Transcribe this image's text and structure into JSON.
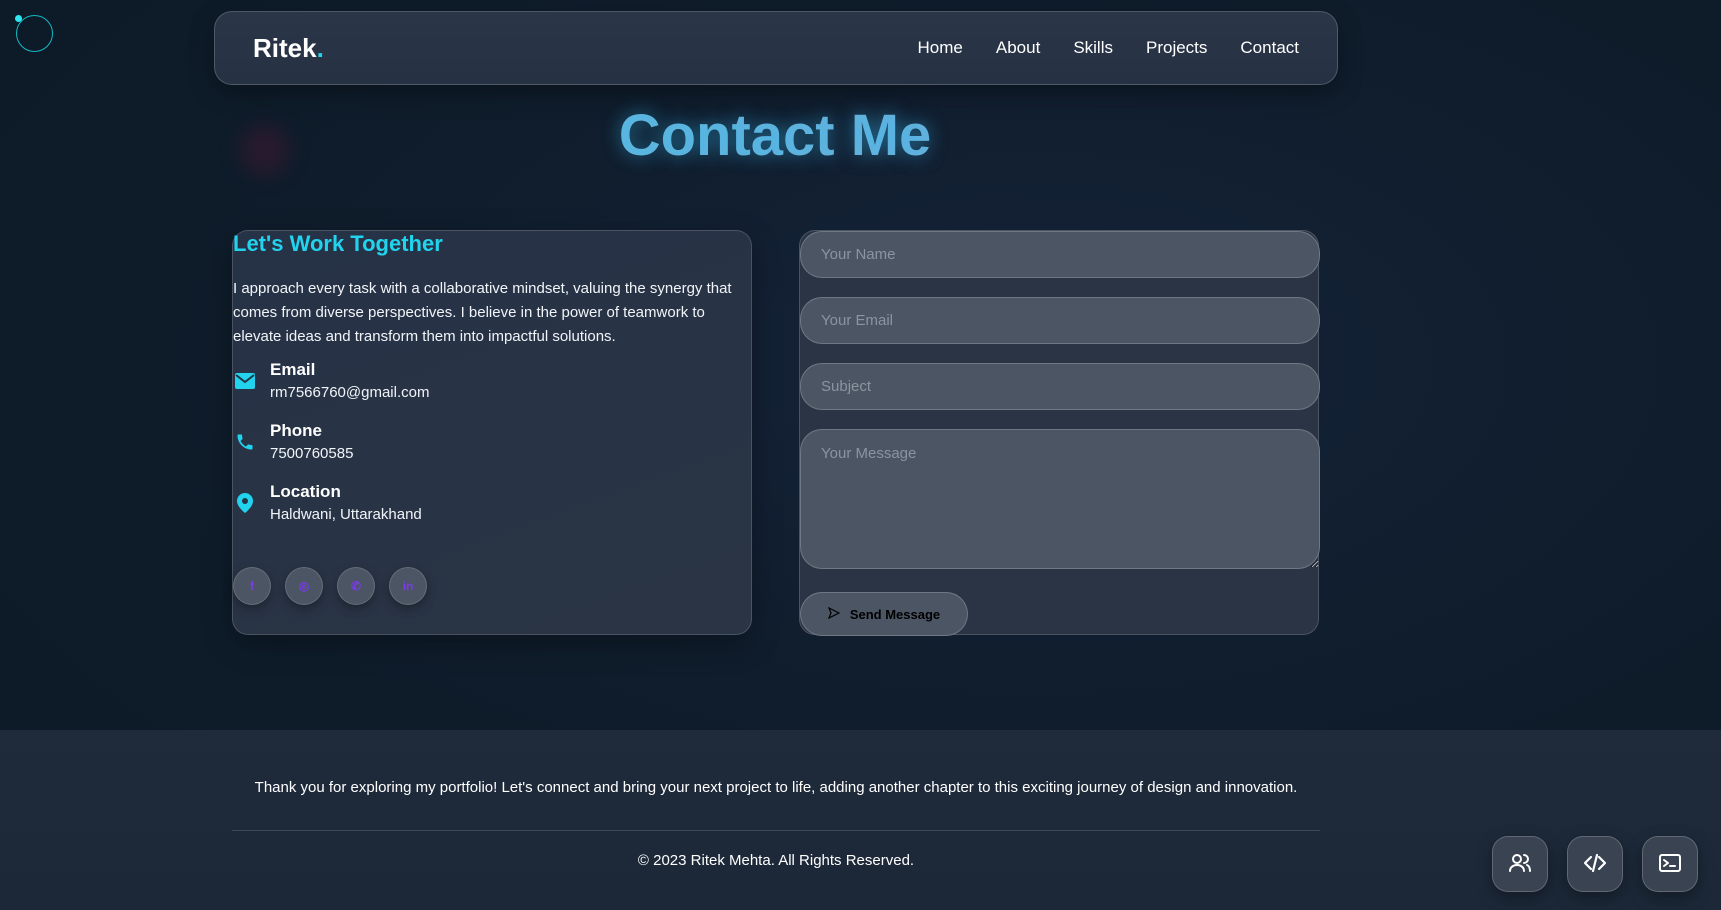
{
  "nav": {
    "logo_text": "Ritek",
    "logo_dot": ".",
    "links": [
      "Home",
      "About",
      "Skills",
      "Projects",
      "Contact"
    ]
  },
  "page_title": "Contact Me",
  "contact_info": {
    "heading": "Let's Work Together",
    "intro": "I approach every task with a collaborative mindset, valuing the synergy that comes from diverse perspectives. I believe in the power of teamwork to elevate ideas and transform them into impactful solutions.",
    "items": [
      {
        "label": "Email",
        "value": "rm7566760@gmail.com",
        "icon": "mail-icon"
      },
      {
        "label": "Phone",
        "value": "7500760585",
        "icon": "phone-icon"
      },
      {
        "label": "Location",
        "value": "Haldwani, Uttarakhand",
        "icon": "location-pin-icon"
      }
    ],
    "socials": [
      {
        "glyph": "f",
        "icon": "facebook-icon"
      },
      {
        "glyph": "◎",
        "icon": "instagram-icon"
      },
      {
        "glyph": "✆",
        "icon": "whatsapp-icon"
      },
      {
        "glyph": "in",
        "icon": "linkedin-icon"
      }
    ]
  },
  "form": {
    "name_placeholder": "Your Name",
    "email_placeholder": "Your Email",
    "subject_placeholder": "Subject",
    "message_placeholder": "Your Message",
    "send_label": "Send Message"
  },
  "footer": {
    "message": "Thank you for exploring my portfolio! Let's connect and bring your next project to life, adding another chapter to this exciting journey of design and innovation.",
    "copyright": "© 2023 Ritek Mehta. All Rights Reserved."
  },
  "fabs": [
    {
      "icon": "users-icon"
    },
    {
      "icon": "code-icon"
    },
    {
      "icon": "terminal-icon"
    }
  ],
  "colors": {
    "accent": "#22d3ee",
    "background": "#0f1d2c",
    "card": "#2a3444",
    "input": "#4b5563",
    "social_glyph": "#7c3aed"
  }
}
